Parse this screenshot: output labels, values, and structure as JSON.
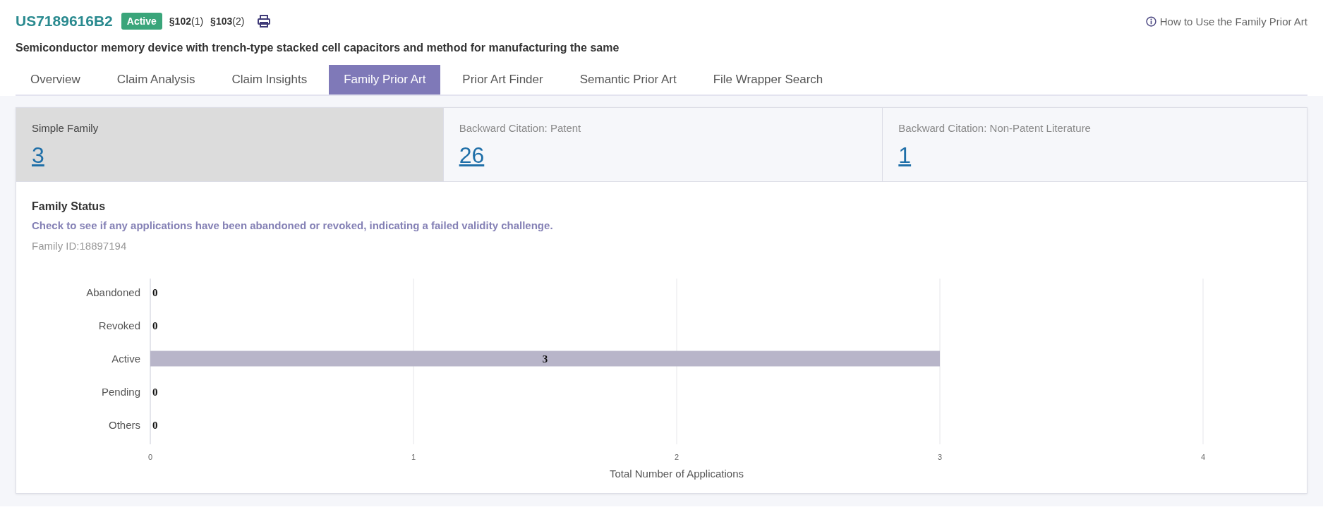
{
  "patent": {
    "number": "US7189616B2",
    "status": "Active",
    "sections": [
      "**§102**(1)",
      "**§103**(2)"
    ],
    "title": "Semiconductor memory device with trench-type stacked cell capacitors and method for manufacturing the same"
  },
  "help_link": "How to Use the Family Prior Art",
  "tabs": [
    {
      "label": "Overview",
      "selected": false
    },
    {
      "label": "Claim Analysis",
      "selected": false
    },
    {
      "label": "Claim Insights",
      "selected": false
    },
    {
      "label": "Family Prior Art",
      "selected": true
    },
    {
      "label": "Prior Art Finder",
      "selected": false
    },
    {
      "label": "Semantic Prior Art",
      "selected": false
    },
    {
      "label": "File Wrapper Search",
      "selected": false
    }
  ],
  "stats": [
    {
      "label": "Simple Family",
      "value": "3",
      "selected": true
    },
    {
      "label": "Backward Citation: Patent",
      "value": "26",
      "selected": false
    },
    {
      "label": "Backward Citation: Non-Patent Literature",
      "value": "1",
      "selected": false
    }
  ],
  "family_status": {
    "heading": "Family Status",
    "description": "Check to see if any applications have been abandoned or revoked, indicating a failed validity challenge.",
    "family_id": "Family ID:18897194",
    "chart_data": {
      "type": "bar",
      "orientation": "horizontal",
      "xlabel": "Total Number of Applications",
      "categories": [
        "Abandoned",
        "Revoked",
        "Active",
        "Pending",
        "Others"
      ],
      "values": [
        0,
        0,
        3,
        0,
        0
      ],
      "xlim": [
        0,
        4
      ],
      "xticks": [
        0,
        1,
        2,
        3,
        4
      ],
      "grid": true,
      "data_labels": true
    }
  }
}
